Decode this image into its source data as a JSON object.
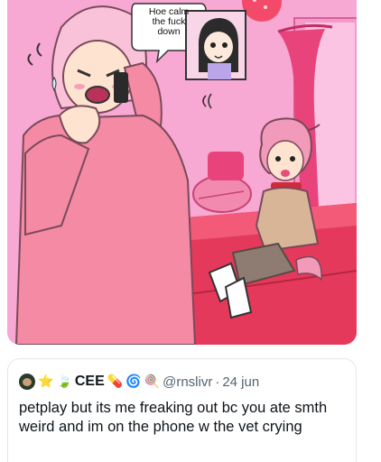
{
  "comic": {
    "speech_bubble": [
      "Hoe calm",
      "the fuck",
      "down"
    ]
  },
  "tweet": {
    "avatar_icon": "user-avatar",
    "badges": [
      "⭐",
      "🍃"
    ],
    "display_name": "CEE",
    "name_emojis": [
      "💊",
      "🌀",
      "🍭"
    ],
    "handle": "@rnslivr",
    "separator": "·",
    "date": "24 jun",
    "text": "petplay but its me freaking out bc you ate smth weird and im on the phone w the vet crying"
  }
}
